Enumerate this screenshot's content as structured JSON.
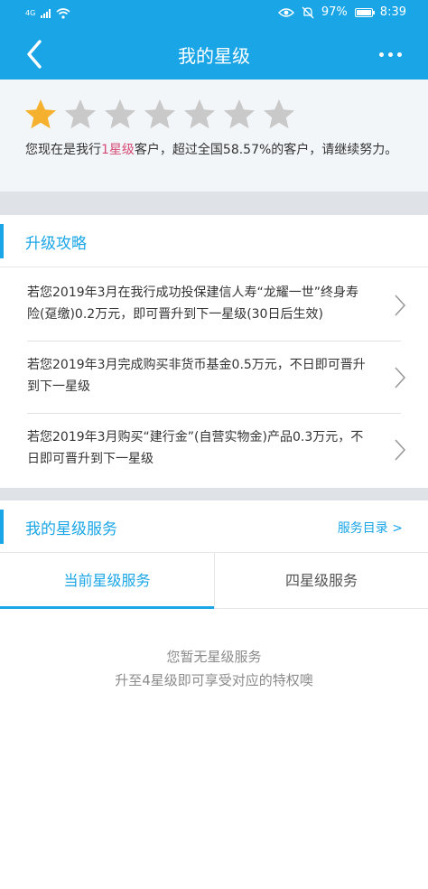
{
  "statusbar": {
    "network": "4G",
    "battery": "97%",
    "time": "8:39"
  },
  "nav": {
    "title": "我的星级"
  },
  "rating": {
    "stars_total": 7,
    "stars_filled": 1,
    "text_prefix": "您现在是我行",
    "text_highlight": "1星级",
    "text_suffix": "客户，超过全国58.57%的客户，请继续努力。"
  },
  "upgrade": {
    "title": "升级攻略",
    "tips": [
      "若您2019年3月在我行成功投保建信人寿“龙耀一世”终身寿险(趸缴)0.2万元，即可晋升到下一星级(30日后生效)",
      "若您2019年3月完成购买非货币基金0.5万元，不日即可晋升到下一星级",
      "若您2019年3月购买“建行金”(自营实物金)产品0.3万元，不日即可晋升到下一星级"
    ]
  },
  "services": {
    "title": "我的星级服务",
    "catalog_link": "服务目录 >",
    "tabs": [
      "当前星级服务",
      "四星级服务"
    ],
    "empty_line1": "您暂无星级服务",
    "empty_line2": "升至4星级即可享受对应的特权噢"
  },
  "colors": {
    "accent": "#1aa6e6",
    "star_filled": "#f5b12e",
    "star_empty": "#c9c9c9",
    "highlight": "#d64a74"
  }
}
